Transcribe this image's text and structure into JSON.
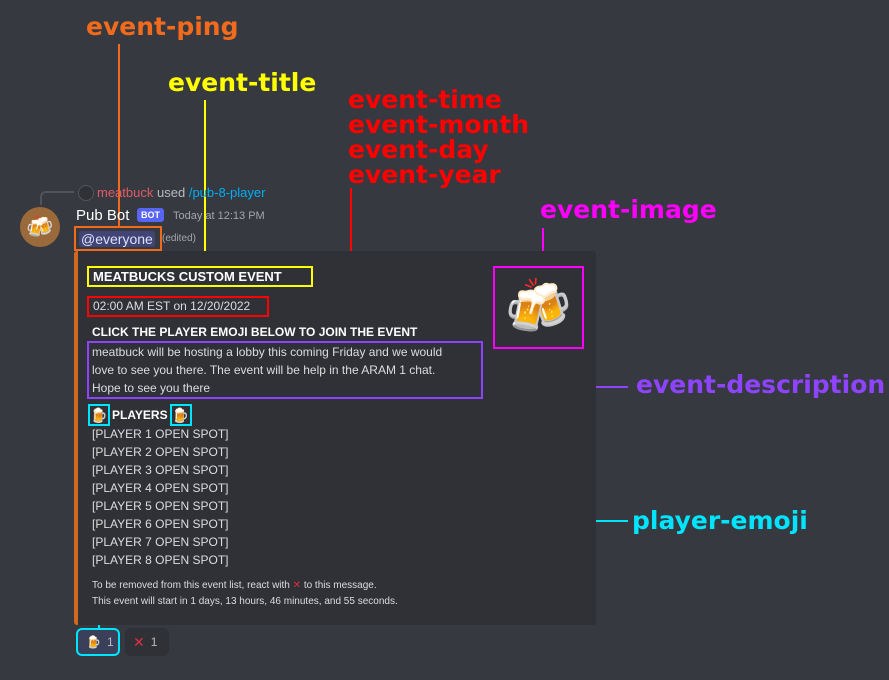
{
  "annotations": {
    "event_ping": "event-ping",
    "event_title": "event-title",
    "event_time": "event-time",
    "event_month": "event-month",
    "event_day": "event-day",
    "event_year": "event-year",
    "event_image": "event-image",
    "event_description": "event-description",
    "player_emoji": "player-emoji"
  },
  "reply": {
    "user": "meatbuck",
    "used": "used",
    "command": "/pub-8-player"
  },
  "message": {
    "avatar_icon": "beer-mugs",
    "username": "Pub Bot",
    "badge": "BOT",
    "timestamp": "Today at 12:13 PM",
    "ping": "@everyone",
    "edited": "(edited)"
  },
  "embed": {
    "accent_color": "#d0691f",
    "title": "MEATBUCKS CUSTOM EVENT",
    "time": "02:00 AM EST on 12/20/2022",
    "image_icon": "clinking-beer-mugs",
    "join_text": "CLICK THE PLAYER EMOJI BELOW TO JOIN THE EVENT",
    "description_lines": [
      "meatbuck will be hosting a lobby this coming Friday and we would",
      "love to see you there. The event will be help in the ARAM 1 chat.",
      "Hope to see you there"
    ],
    "players_label": "PLAYERS",
    "player_emoji": "🍺",
    "players": [
      "[PLAYER 1 OPEN SPOT]",
      "[PLAYER 2 OPEN SPOT]",
      "[PLAYER 3 OPEN SPOT]",
      "[PLAYER 4 OPEN SPOT]",
      "[PLAYER 5 OPEN SPOT]",
      "[PLAYER 6 OPEN SPOT]",
      "[PLAYER 7 OPEN SPOT]",
      "[PLAYER 8 OPEN SPOT]"
    ],
    "footer_line1_a": "To be removed from this event list, react with",
    "footer_line1_b": "to this message.",
    "footer_line2": "This event will start in 1 days, 13 hours, 46 minutes, and 55 seconds."
  },
  "reactions": [
    {
      "emoji": "🍺",
      "count": "1"
    },
    {
      "emoji": "❌",
      "count": "1"
    }
  ],
  "colors": {
    "background": "#36393f",
    "embed_bg": "#2f3136",
    "ping_annotation": "#f26b1d",
    "title_annotation": "#ffff00",
    "time_annotation": "#ff0000",
    "image_annotation": "#ff00ff",
    "description_annotation": "#8e44ff",
    "emoji_annotation": "#00e5ff"
  }
}
